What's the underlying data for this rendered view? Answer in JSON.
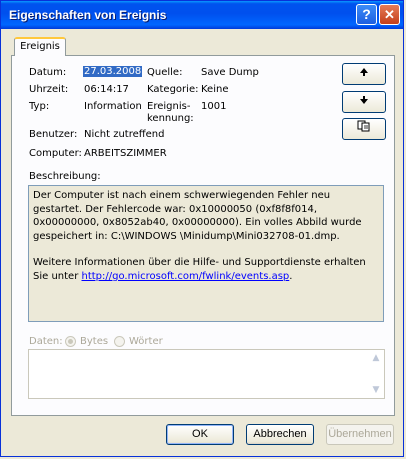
{
  "window": {
    "title": "Eigenschaften von Ereignis",
    "help_button": "?",
    "close_button": "✕"
  },
  "tab": {
    "label": "Ereignis"
  },
  "fields": {
    "datum_label": "Datum:",
    "datum_value": "27.03.2008",
    "uhrzeit_label": "Uhrzeit:",
    "uhrzeit_value": "06:14:17",
    "typ_label": "Typ:",
    "typ_value": "Information",
    "benutzer_label": "Benutzer:",
    "benutzer_value": "Nicht zutreffend",
    "computer_label": "Computer:",
    "computer_value": "ARBEITSZIMMER",
    "quelle_label": "Quelle:",
    "quelle_value": "Save Dump",
    "kategorie_label": "Kategorie:",
    "kategorie_value": "Keine",
    "kennung_label_1": "Ereignis-",
    "kennung_label_2": "kennung:",
    "kennung_value": "1001"
  },
  "nav": {
    "up_icon": "arrow-up",
    "down_icon": "arrow-down",
    "copy_icon": "copy"
  },
  "description": {
    "label": "Beschreibung:",
    "paragraph1": "Der Computer ist nach einem schwerwiegenden Fehler neu gestartet. Der Fehlercode war: 0x10000050 (0xf8f8f014, 0x00000000, 0x8052ab40, 0x00000000). Ein volles Abbild wurde gespeichert in: C:\\WINDOWS \\Minidump\\Mini032708-01.dmp.",
    "paragraph2_prefix": "Weitere Informationen über die Hilfe- und Supportdienste erhalten Sie unter ",
    "link": "http://go.microsoft.com/fwlink/events.asp",
    "paragraph2_suffix": "."
  },
  "data": {
    "label": "Daten:",
    "option_bytes": "Bytes",
    "option_words": "Wörter",
    "selected": "Bytes"
  },
  "buttons": {
    "ok": "OK",
    "cancel": "Abbrechen",
    "apply": "Übernehmen"
  },
  "colors": {
    "titlebar": "#0053ee",
    "selection": "#316ac5",
    "link": "#0000ff",
    "dialog_bg": "#ece9d8"
  }
}
